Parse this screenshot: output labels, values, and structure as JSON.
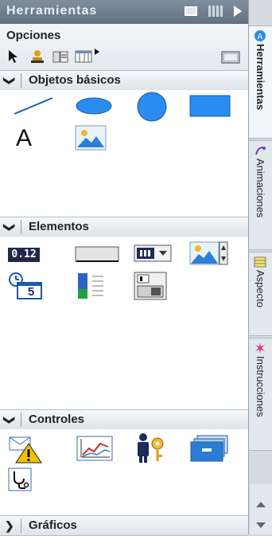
{
  "panel": {
    "title": "Herramientas",
    "options_label": "Opciones"
  },
  "sections": {
    "basic": {
      "chevron": "❯",
      "title": "Objetos básicos"
    },
    "elements": {
      "chevron": "❯",
      "title": "Elementos",
      "io_text": "0.12",
      "date_day": "5"
    },
    "controls": {
      "chevron": "❯",
      "title": "Controles"
    },
    "graphics": {
      "chevron": "❯",
      "title": "Gráficos"
    }
  },
  "basic_objects": {
    "text_glyph": "A"
  },
  "side_tabs": [
    {
      "label": "Herramientas",
      "active": true
    },
    {
      "label": "Animaciones",
      "active": false
    },
    {
      "label": "Aspecto",
      "active": false
    },
    {
      "label": "Instrucciones",
      "active": false
    }
  ],
  "colors": {
    "title_bar": "#6f7f8e",
    "accent_blue": "#2b8cf0",
    "section_header": "#e7ebef"
  }
}
